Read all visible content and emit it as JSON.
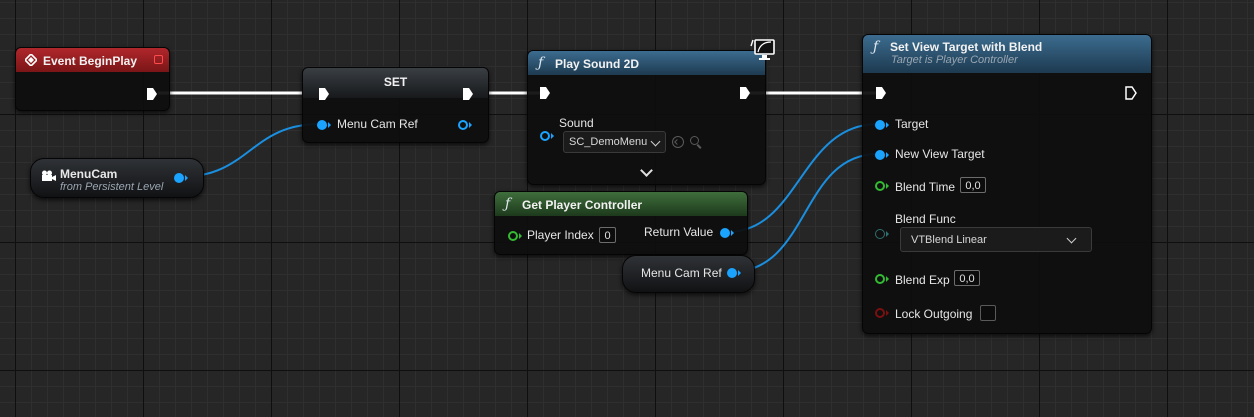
{
  "nodes": {
    "begin_play": {
      "title": "Event BeginPlay"
    },
    "set_node": {
      "title": "SET",
      "input_label": "Menu Cam Ref"
    },
    "menucam": {
      "title": "MenuCam",
      "subtitle": "from Persistent Level"
    },
    "play_sound": {
      "title": "Play Sound 2D",
      "sound_label": "Sound",
      "sound_value": "SC_DemoMenu"
    },
    "get_player_controller": {
      "title": "Get Player Controller",
      "index_label": "Player Index",
      "index_value": "0",
      "return_label": "Return Value"
    },
    "menu_cam_ref_getter": {
      "label": "Menu Cam Ref"
    },
    "set_view_target": {
      "title": "Set View Target with Blend",
      "subtitle": "Target is Player Controller",
      "target_label": "Target",
      "new_view_target_label": "New View Target",
      "blend_time_label": "Blend Time",
      "blend_time_value": "0,0",
      "blend_func_label": "Blend Func",
      "blend_func_value": "VTBlend Linear",
      "blend_exp_label": "Blend Exp",
      "blend_exp_value": "0,0",
      "lock_outgoing_label": "Lock Outgoing"
    }
  },
  "icons": [
    "event-icon",
    "stop-icon",
    "camera-actor-icon",
    "function-icon",
    "client-only-monitor-icon",
    "browse-icon",
    "search-icon",
    "expand-chevron-icon"
  ],
  "colors": {
    "event_header": "#9c1f22",
    "function_header": "#2f5a78",
    "pure_function_header": "#2f5a2e",
    "object_pin": "#1aa3ff",
    "float_pin": "#33bb33",
    "bool_pin": "#7a1010",
    "enum_pin": "#2f6f70",
    "exec_wire": "#ffffff"
  }
}
